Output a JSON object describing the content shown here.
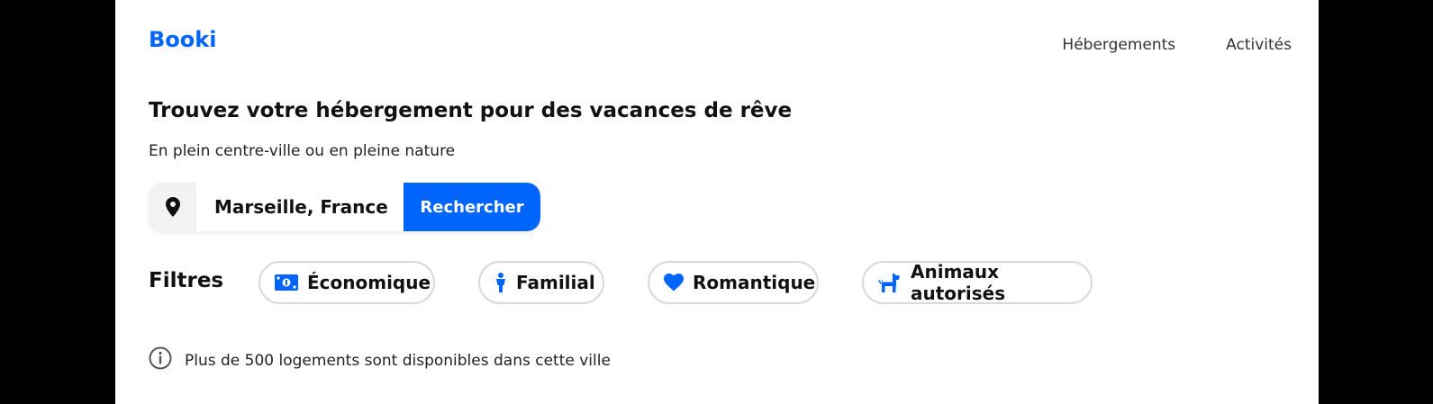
{
  "header": {
    "logo": "Booki",
    "nav": [
      "Hébergements",
      "Activités"
    ]
  },
  "hero": {
    "title": "Trouvez votre hébergement pour des vacances de rêve",
    "subtitle": "En plein centre-ville ou en pleine nature"
  },
  "search": {
    "icon": "location-pin-icon",
    "value": "Marseille, France",
    "button_label": "Rechercher"
  },
  "filters": {
    "label": "Filtres",
    "items": [
      {
        "label": "Économique",
        "icon": "money-icon"
      },
      {
        "label": "Familial",
        "icon": "person-icon"
      },
      {
        "label": "Romantique",
        "icon": "heart-icon"
      },
      {
        "label": "Animaux autorisés",
        "icon": "dog-icon"
      }
    ]
  },
  "info": {
    "icon": "info-icon",
    "text": "Plus de 500 logements sont disponibles dans cette ville"
  },
  "colors": {
    "accent": "#0065FC",
    "search_icon_bg": "#F2F2F2",
    "chip_border": "#D9D9D9"
  }
}
